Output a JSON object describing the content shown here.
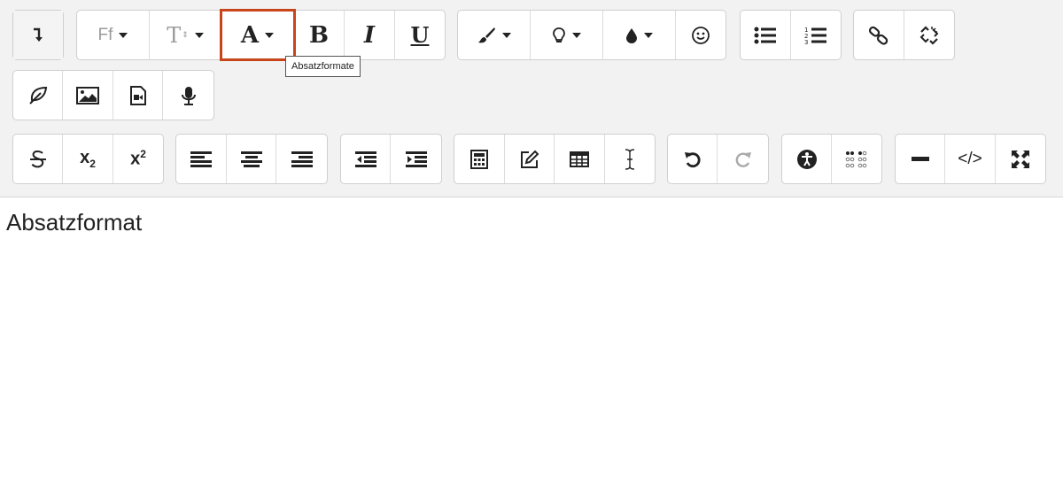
{
  "toolbar": {
    "tooltip": "Absatzformate",
    "font_family_label": "Ff",
    "font_size_label": "T",
    "paragraph_format_label": "A",
    "bold_label": "B",
    "italic_label": "I",
    "underline_label": "U",
    "subscript_label": "x",
    "subscript_sub": "2",
    "superscript_label": "x",
    "superscript_sup": "2",
    "code_view_label": "</>",
    "selected_color": "#c8451b"
  },
  "icons": [
    "toggle-toolbar-icon",
    "font-family-icon",
    "font-size-icon",
    "paragraph-format-icon",
    "bold-icon",
    "italic-icon",
    "underline-icon",
    "paint-brush-icon",
    "lightbulb-icon",
    "color-drop-icon",
    "emoticon-icon",
    "unordered-list-icon",
    "ordered-list-icon",
    "link-icon",
    "unlink-icon",
    "leaf-icon",
    "image-icon",
    "video-icon",
    "microphone-icon",
    "strikethrough-icon",
    "subscript-icon",
    "superscript-icon",
    "align-left-icon",
    "align-center-icon",
    "align-right-icon",
    "outdent-icon",
    "indent-icon",
    "calculator-icon",
    "edit-icon",
    "table-icon",
    "text-cursor-icon",
    "undo-icon",
    "redo-icon",
    "accessibility-icon",
    "braille-icon",
    "horizontal-line-icon",
    "code-view-icon",
    "fullscreen-icon"
  ],
  "editor": {
    "content": "Absatzformat"
  }
}
